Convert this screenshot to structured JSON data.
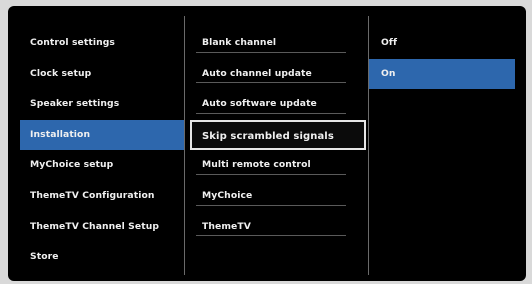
{
  "left_menu": {
    "items": [
      {
        "label": "Control settings"
      },
      {
        "label": "Clock setup"
      },
      {
        "label": "Speaker settings"
      },
      {
        "label": "Installation",
        "selected": true
      },
      {
        "label": "MyChoice setup"
      },
      {
        "label": "ThemeTV Configuration"
      },
      {
        "label": "ThemeTV Channel Setup"
      },
      {
        "label": "Store"
      }
    ]
  },
  "middle_menu": {
    "items": [
      {
        "label": "Blank channel"
      },
      {
        "label": "Auto channel update"
      },
      {
        "label": "Auto software update"
      },
      {
        "label": "Skip scrambled signals",
        "focused": true
      },
      {
        "label": "Multi remote control"
      },
      {
        "label": "MyChoice"
      },
      {
        "label": "ThemeTV"
      }
    ]
  },
  "right_menu": {
    "items": [
      {
        "label": "Off"
      },
      {
        "label": "On",
        "selected": true
      }
    ]
  },
  "colors": {
    "selection": "#2d67ad",
    "background": "#000000",
    "focus_border": "#e6e6e6"
  }
}
